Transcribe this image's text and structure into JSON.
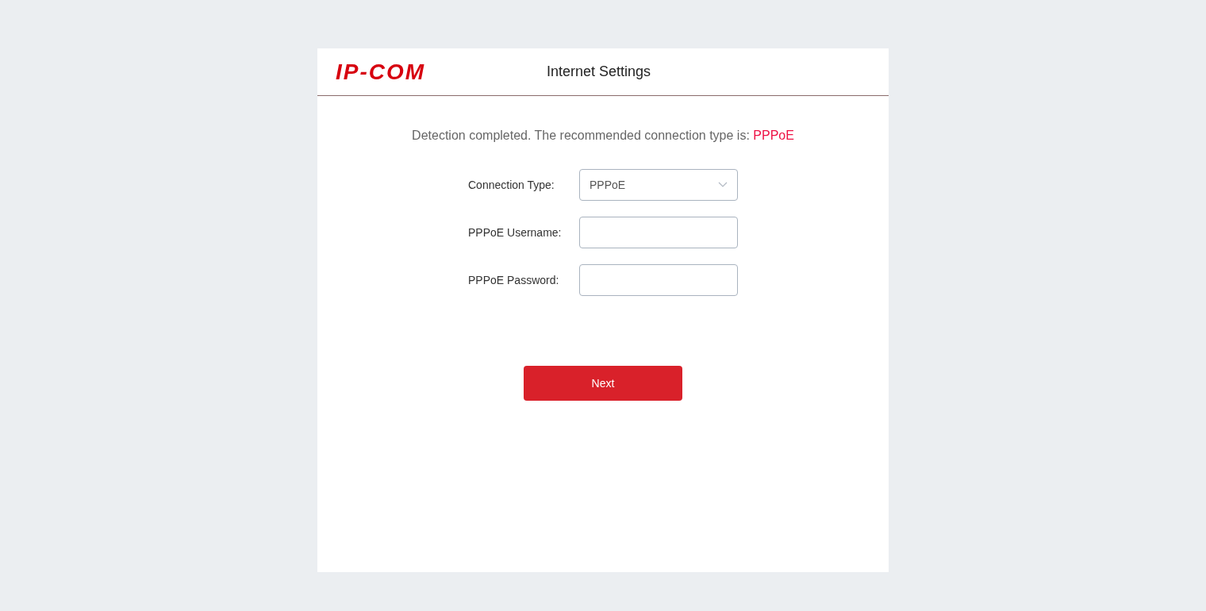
{
  "header": {
    "logo": "IP-COM",
    "title": "Internet Settings"
  },
  "detection": {
    "message": "Detection completed. The recommended connection type is: ",
    "recommended": "PPPoE"
  },
  "fields": [
    {
      "kind": "select",
      "label": "Connection Type:",
      "value": "PPPoE"
    },
    {
      "kind": "text",
      "label": "PPPoE Username:"
    },
    {
      "kind": "password",
      "label": "PPPoE Password:"
    }
  ],
  "next_button": "Next"
}
